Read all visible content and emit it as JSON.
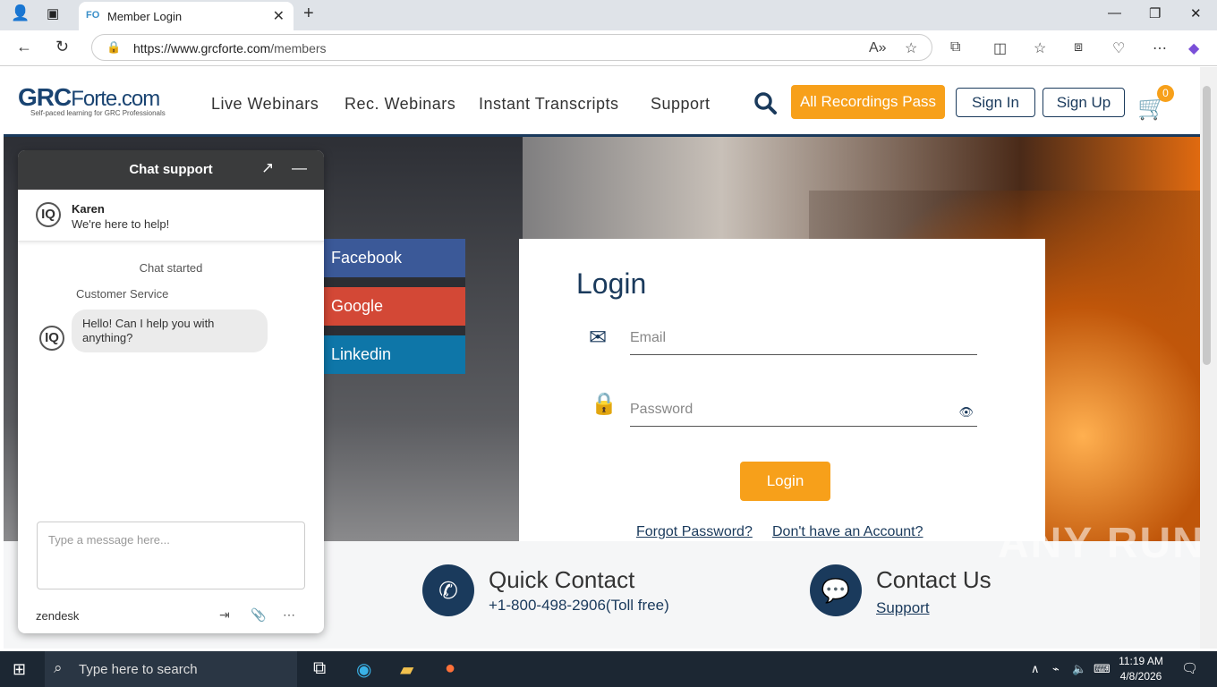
{
  "browser": {
    "tab_title": "Member Login",
    "tab_favicon": "FO",
    "url_domain": "https://www.grcforte.com",
    "url_path": "/members"
  },
  "site": {
    "logo_main": "GRC",
    "logo_accent": "Forte",
    "logo_suffix": ".com",
    "logo_tagline": "Self-paced learning for GRC Professionals",
    "nav": [
      "Live Webinars",
      "Rec. Webinars",
      "Instant Transcripts",
      "Support"
    ],
    "all_recordings_pass": "All Recordings Pass",
    "sign_in": "Sign In",
    "sign_up": "Sign Up",
    "cart_count": "0"
  },
  "social": [
    "Facebook",
    "Google",
    "Linkedin"
  ],
  "login": {
    "title": "Login",
    "email_placeholder": "Email",
    "password_placeholder": "Password",
    "button": "Login",
    "forgot": "Forgot Password?",
    "no_account": "Don't have an Account?"
  },
  "contact": {
    "quick_title": "Quick Contact",
    "quick_phone": "+1-800-498-2906(Toll free)",
    "us_title": "Contact Us",
    "us_link": "Support"
  },
  "chat": {
    "header": "Chat support",
    "agent_name": "Karen",
    "agent_status": "We're here to help!",
    "started": "Chat started",
    "sender": "Customer Service",
    "message": "Hello! Can I help you with anything?",
    "input_placeholder": "Type a message here...",
    "brand": "zendesk"
  },
  "watermark": "ANY RUN",
  "taskbar": {
    "search_placeholder": "Type here to search",
    "time": "11:19 AM",
    "date": "4/8/2026"
  },
  "colors": {
    "brand_navy": "#1a3a5c",
    "accent_orange": "#f7a01a",
    "facebook": "#3b5998",
    "google": "#d34836",
    "linkedin": "#0e76a8"
  }
}
